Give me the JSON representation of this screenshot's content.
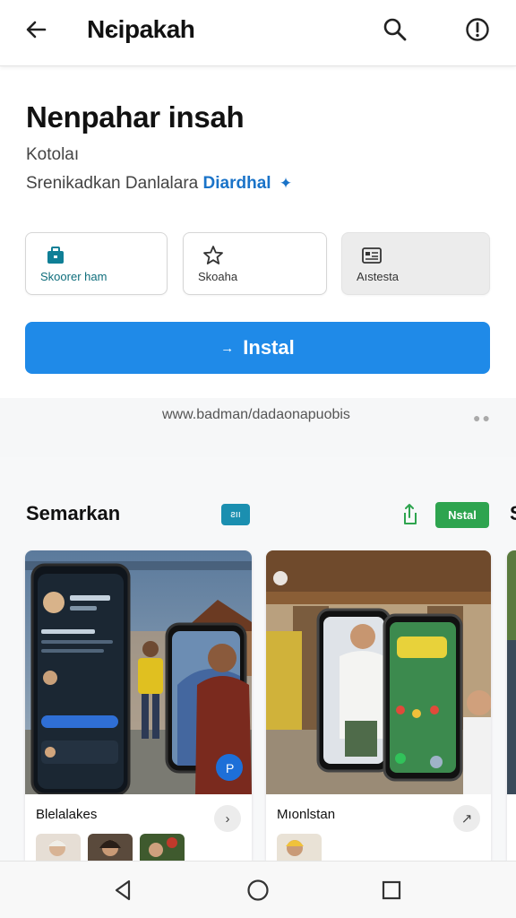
{
  "topbar": {
    "title": "Nєipakah",
    "back_icon": "arrow-back-icon",
    "search_icon": "search-icon",
    "alert_icon": "alert-circle-icon"
  },
  "app": {
    "title": "Nenpahar insah",
    "category": "Kotolaı",
    "developer_prefix": "Srenikadkan Danlalara",
    "developer_name": "Diardhal",
    "verified_icon": "verified-badge-icon"
  },
  "actions": [
    {
      "label": "Skoorer ham",
      "icon": "briefcase-icon"
    },
    {
      "label": "Skoaha",
      "icon": "star-outline-icon"
    },
    {
      "label": "Aıstesta",
      "icon": "id-card-icon"
    }
  ],
  "install": {
    "label": "Instal",
    "arrow": "→"
  },
  "url": {
    "text": "www.badman/dadaonapuobis",
    "more_icon": "more-dots-icon"
  },
  "section": {
    "title": "Semarkan",
    "badge": "ƨıı",
    "share_icon": "share-icon",
    "install_label": "Nstal",
    "more_label": "S"
  },
  "screenshots": [
    {
      "caption": "Blelalakes",
      "chevron": "›",
      "phone_name": "Stoorfalsee",
      "phone_sub": "Gaam naoa",
      "phone_note": "Cıuaw nardaıt",
      "phone_chip": "Clasbs nmbeo"
    },
    {
      "caption": "Mıonlstan",
      "chevron": "↗",
      "header_text": "Icoohmilan"
    }
  ],
  "colors": {
    "install_blue": "#1f8ae8",
    "verified_blue": "#1a73c8",
    "teal_label": "#0f6e7c",
    "badge_teal": "#1b8fb0",
    "install_green": "#2ea44f"
  },
  "navbar": {
    "back_icon": "nav-back-triangle-icon",
    "home_icon": "nav-home-circle-icon",
    "recent_icon": "nav-recents-square-icon"
  }
}
